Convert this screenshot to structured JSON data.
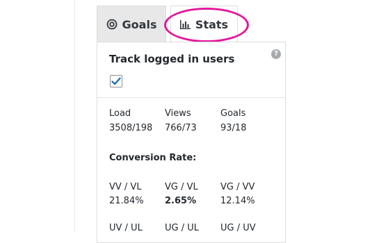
{
  "tabs": [
    {
      "label": "Goals",
      "icon": "target-icon"
    },
    {
      "label": "Stats",
      "icon": "bar-chart-icon",
      "active": true
    }
  ],
  "highlight_color": "#e3179a",
  "track": {
    "label": "Track logged in users",
    "checked": true,
    "help": "?"
  },
  "stats": {
    "headers": [
      "Load",
      "Views",
      "Goals"
    ],
    "values": [
      "3508/198",
      "766/73",
      "93/18"
    ]
  },
  "conversion": {
    "title": "Conversion Rate:",
    "labels": [
      "VV / VL",
      "VG / VL",
      "VG / VV"
    ],
    "values": [
      "21.84%",
      "2.65%",
      "12.14%"
    ],
    "partial_labels": [
      "UV / UL",
      "UG / UL",
      "UG / UV"
    ]
  }
}
